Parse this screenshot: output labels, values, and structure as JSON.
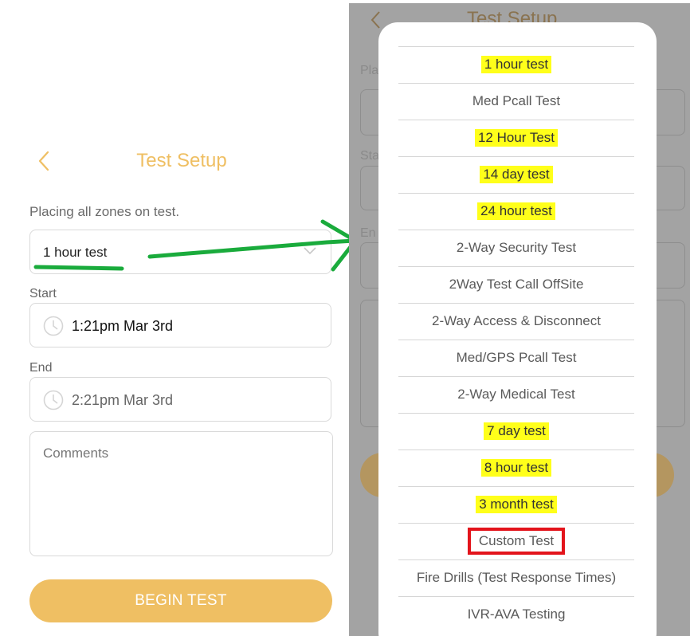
{
  "left": {
    "title": "Test Setup",
    "subtitle": "Placing all zones on test.",
    "selected_test": "1 hour test",
    "start_label": "Start",
    "start_value": "1:21pm Mar 3rd",
    "end_label": "End",
    "end_value": "2:21pm Mar 3rd",
    "comments_placeholder": "Comments",
    "begin_button": "BEGIN TEST"
  },
  "right": {
    "ghost_title": "Test Setup",
    "ghost_labels": [
      "Pla",
      "Sta",
      "En"
    ],
    "options": [
      {
        "label": "1 hour test",
        "highlight": true,
        "boxed": false
      },
      {
        "label": "Med Pcall Test",
        "highlight": false,
        "boxed": false
      },
      {
        "label": "12 Hour Test",
        "highlight": true,
        "boxed": false
      },
      {
        "label": "14 day test",
        "highlight": true,
        "boxed": false
      },
      {
        "label": "24 hour test",
        "highlight": true,
        "boxed": false
      },
      {
        "label": "2-Way Security Test",
        "highlight": false,
        "boxed": false
      },
      {
        "label": "2Way Test Call OffSite",
        "highlight": false,
        "boxed": false
      },
      {
        "label": "2-Way Access & Disconnect",
        "highlight": false,
        "boxed": false
      },
      {
        "label": "Med/GPS Pcall Test",
        "highlight": false,
        "boxed": false
      },
      {
        "label": "2-Way Medical Test",
        "highlight": false,
        "boxed": false
      },
      {
        "label": "7 day test",
        "highlight": true,
        "boxed": false
      },
      {
        "label": "8 hour test",
        "highlight": true,
        "boxed": false
      },
      {
        "label": "3 month test",
        "highlight": true,
        "boxed": false
      },
      {
        "label": "Custom Test",
        "highlight": false,
        "boxed": true
      },
      {
        "label": "Fire Drills (Test Response Times)",
        "highlight": false,
        "boxed": false
      },
      {
        "label": "IVR-AVA Testing",
        "highlight": false,
        "boxed": false
      }
    ]
  },
  "colors": {
    "accent": "#efbf63",
    "highlight": "#ffff1a",
    "annotation_green": "#1aab3c",
    "annotation_red": "#e3141b",
    "overlay_gray": "#a3a3a3"
  }
}
